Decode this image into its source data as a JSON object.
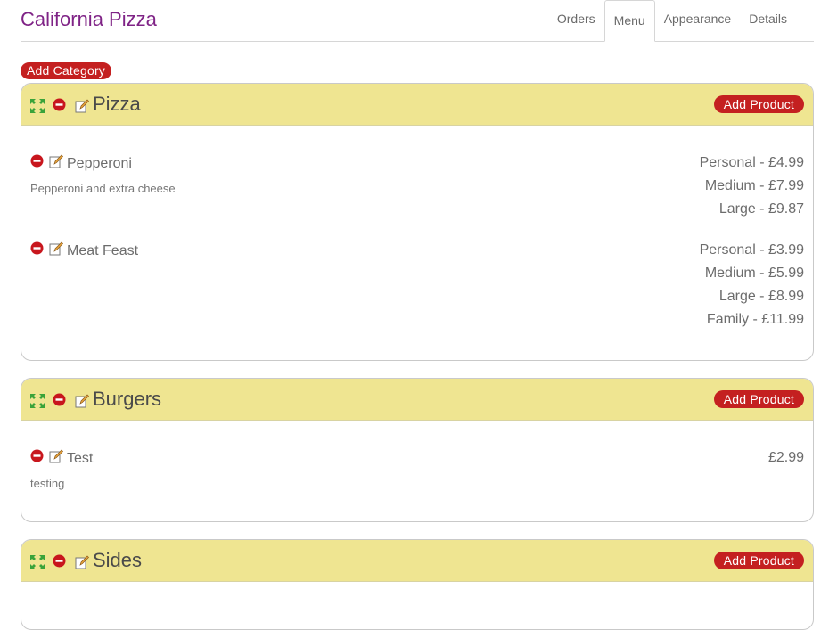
{
  "app": {
    "title": "California Pizza"
  },
  "nav": {
    "tabs": [
      "Orders",
      "Menu",
      "Appearance",
      "Details"
    ],
    "active": "Menu"
  },
  "toolbar": {
    "add_category_label": "Add Category"
  },
  "colors": {
    "brand": "#7f2386",
    "accent": "#c42020",
    "category_header": "#efe591"
  },
  "icons": {
    "move": "move-arrows-icon",
    "delete": "remove-icon",
    "edit": "edit-icon"
  },
  "categories": [
    {
      "name": "Pizza",
      "add_product_label": "Add Product",
      "products": [
        {
          "name": "Pepperoni",
          "description": "Pepperoni and extra cheese",
          "prices": [
            "Personal - £4.99",
            "Medium - £7.99",
            "Large - £9.87"
          ]
        },
        {
          "name": "Meat Feast",
          "description": "",
          "prices": [
            "Personal - £3.99",
            "Medium - £5.99",
            "Large - £8.99",
            "Family - £11.99"
          ]
        }
      ]
    },
    {
      "name": "Burgers",
      "add_product_label": "Add Product",
      "products": [
        {
          "name": "Test",
          "description": "testing",
          "prices": [
            "£2.99"
          ]
        }
      ]
    },
    {
      "name": "Sides",
      "add_product_label": "Add Product",
      "products": []
    }
  ]
}
